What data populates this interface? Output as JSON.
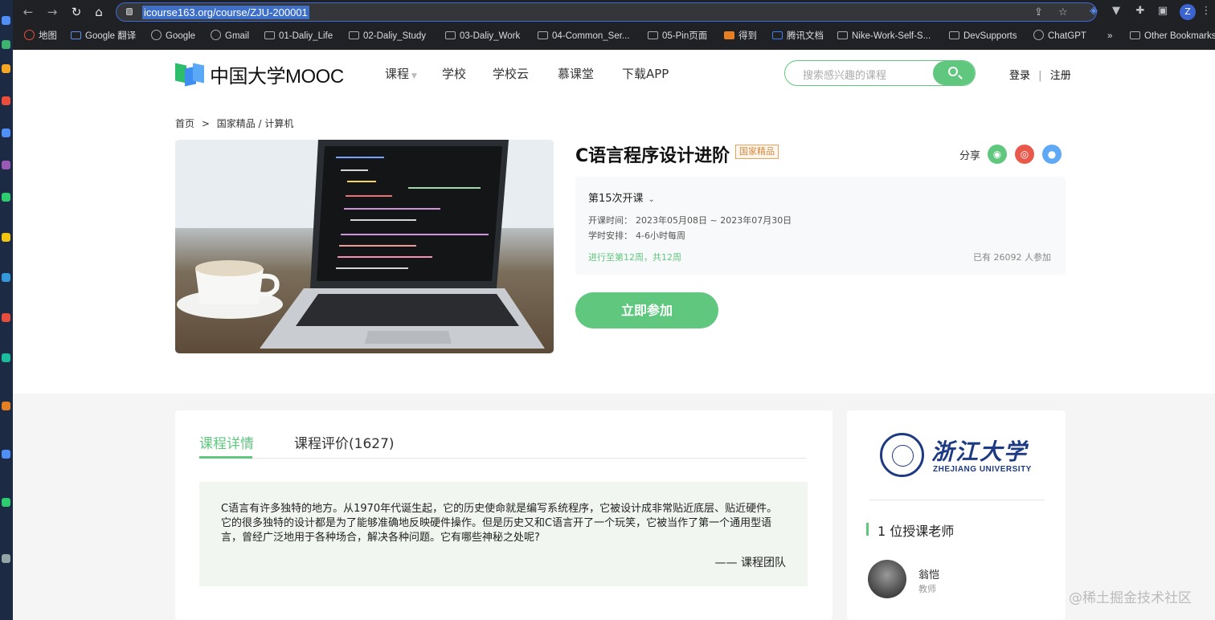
{
  "browser": {
    "url": "icourse163.org/course/ZJU-200001",
    "profile_initial": "Z",
    "bookmarks": [
      {
        "label": "地图"
      },
      {
        "label": "Google 翻译"
      },
      {
        "label": "Google"
      },
      {
        "label": "Gmail"
      },
      {
        "label": "01-Daliy_Life"
      },
      {
        "label": "02-Daliy_Study"
      },
      {
        "label": "03-Daliy_Work"
      },
      {
        "label": "04-Common_Ser..."
      },
      {
        "label": "05-Pin页面"
      },
      {
        "label": "得到"
      },
      {
        "label": "腾讯文档"
      },
      {
        "label": "Nike-Work-Self-S..."
      },
      {
        "label": "DevSupports"
      },
      {
        "label": "ChatGPT"
      }
    ],
    "overflow": "»",
    "other_bookmarks": "Other Bookmarks"
  },
  "site": {
    "logo_text": "中国大学MOOC",
    "nav": [
      "课程",
      "学校",
      "学校云",
      "慕课堂",
      "下载APP"
    ],
    "search_placeholder": "搜索感兴趣的课程",
    "login": "登录",
    "register": "注册"
  },
  "breadcrumb": {
    "home": "首页",
    "sep": ">",
    "path": "国家精品 / 计算机"
  },
  "course": {
    "title": "C语言程序设计进阶",
    "badge": "国家精品",
    "share_label": "分享",
    "term": "第15次开课",
    "date_label": "开课时间：",
    "date_value": "2023年05月08日 ~ 2023年07月30日",
    "hours_label": "学时安排：",
    "hours_value": "4-6小时每周",
    "progress": "进行至第12周，共12周",
    "participants": "已有 26092 人参加",
    "join_button": "立即参加"
  },
  "tabs": [
    {
      "label": "课程详情",
      "active": true
    },
    {
      "label": "课程评价(1627)",
      "active": false
    }
  ],
  "description": {
    "text": "C语言有许多独特的地方。从1970年代诞生起，它的历史使命就是编写系统程序，它被设计成非常贴近底层、贴近硬件。它的很多独特的设计都是为了能够准确地反映硬件操作。但是历史又和C语言开了一个玩笑，它被当作了第一个通用型语言，曾经广泛地用于各种场合，解决各种问题。它有哪些神秘之处呢?",
    "signature": "—— 课程团队"
  },
  "school": {
    "name_cn": "浙江大学",
    "name_en": "ZHEJIANG UNIVERSITY"
  },
  "teachers": {
    "heading": "1 位授课老师",
    "list": [
      {
        "name": "翁恺",
        "role": "教师"
      }
    ]
  },
  "watermark": "@稀土掘金技术社区",
  "colors": {
    "accent": "#5fc87e",
    "badge": "#d6873b",
    "school": "#1d3a82"
  }
}
